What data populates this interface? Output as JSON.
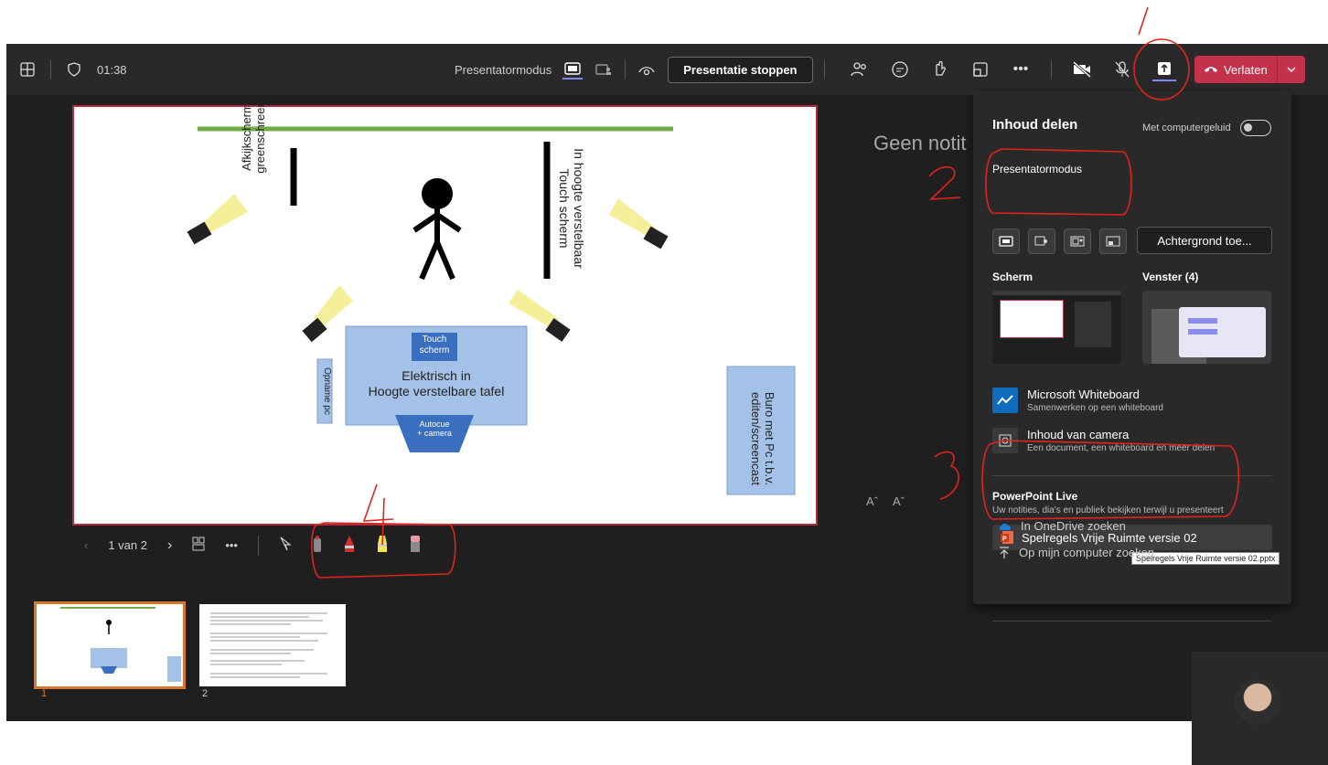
{
  "toolbar": {
    "timer": "01:38",
    "presenter_mode_label": "Presentatormodus",
    "stop_presenting": "Presentatie stoppen",
    "leave": "Verlaten"
  },
  "slide": {
    "labels": {
      "afkijkscherm": "Afkijkscherm",
      "greenscreen": "greenschreen",
      "hoogte_verstelbaar": "In hoogte verstelbaar",
      "touch_scherm_vertical": "Touch scherm",
      "touch_scherm_box": "Touch scherm",
      "tafel_line1": "Elektrisch in",
      "tafel_line2": "Hoogte verstelbare tafel",
      "opname_pc": "Opname pc",
      "autocue_line1": "Autocue",
      "autocue_line2": "+ camera",
      "buro_line1": "Buro met Pc t.b.v.",
      "buro_line2": "editen/screencast"
    }
  },
  "notes_text": "Geen notit",
  "font_controls": [
    "Aˆ",
    "Aˇ"
  ],
  "slide_nav": {
    "counter": "1 van 2"
  },
  "thumbnails": [
    {
      "number": "1"
    },
    {
      "number": "2"
    }
  ],
  "share_panel": {
    "title": "Inhoud delen",
    "computer_sound": "Met computergeluid",
    "presenter_mode": "Presentatormodus",
    "background_button": "Achtergrond toe...",
    "screen": "Scherm",
    "window": "Venster (4)",
    "whiteboard_title": "Microsoft Whiteboard",
    "whiteboard_sub": "Samenwerken op een whiteboard",
    "camera_title": "Inhoud van camera",
    "camera_sub": "Een document, een whiteboard en meer delen",
    "ppt_live_title": "PowerPoint Live",
    "ppt_live_sub": "Uw notities, dia's en publiek bekijken terwijl u presenteert",
    "ppt_file": "Spelregels Vrije Ruimte versie 02",
    "tooltip": "Spelregels Vrije Ruimte versie 02.pptx",
    "onedrive": "In OneDrive zoeken",
    "computer": "Op mijn computer zoeken"
  },
  "annotations": [
    "1",
    "2",
    "3",
    "4"
  ],
  "colors": {
    "accent": "#7f85f5",
    "leave": "#c4314b",
    "annotation": "#e0241d",
    "active_thumb": "#d5762e"
  }
}
